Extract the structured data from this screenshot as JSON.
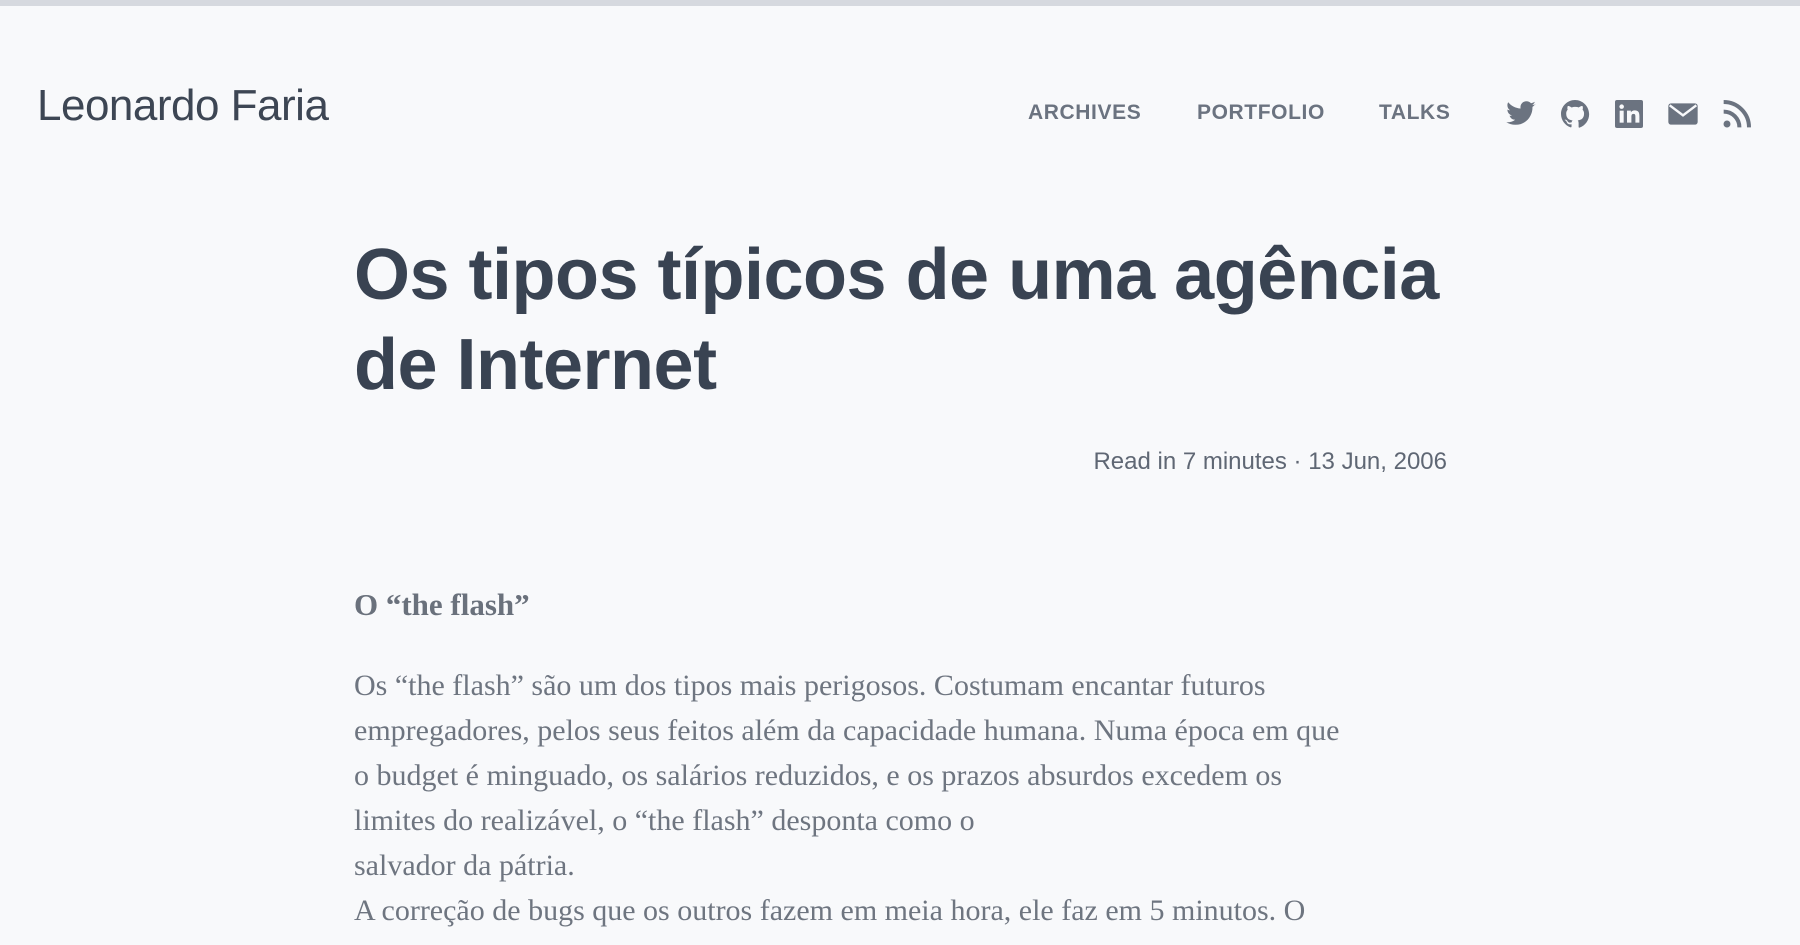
{
  "header": {
    "site_title": "Leonardo Faria",
    "nav": {
      "archives": "ARCHIVES",
      "portfolio": "PORTFOLIO",
      "talks": "TALKS"
    },
    "social_icons": [
      "twitter-icon",
      "github-icon",
      "linkedin-icon",
      "email-icon",
      "rss-icon"
    ]
  },
  "post": {
    "title": "Os tipos típicos de uma agência de Internet",
    "meta": "Read in 7 minutes · 13 Jun, 2006",
    "section_heading": "O “the flash”",
    "lines": [
      "Os “the flash” são um dos tipos mais perigosos. Costumam encantar futuros",
      "empregadores, pelos seus feitos além da capacidade humana. Numa época em que",
      "o budget é minguado, os salários reduzidos, e os prazos absurdos excedem os",
      "limites do realizável, o “the flash” desponta como o",
      "salvador da pátria.",
      "A correção de bugs que os outros fazem em meia hora, ele faz em 5 minutos. O"
    ]
  },
  "colors": {
    "background": "#f8f9fb",
    "title": "#394352",
    "nav": "#6b7380",
    "body": "#6e7580"
  }
}
